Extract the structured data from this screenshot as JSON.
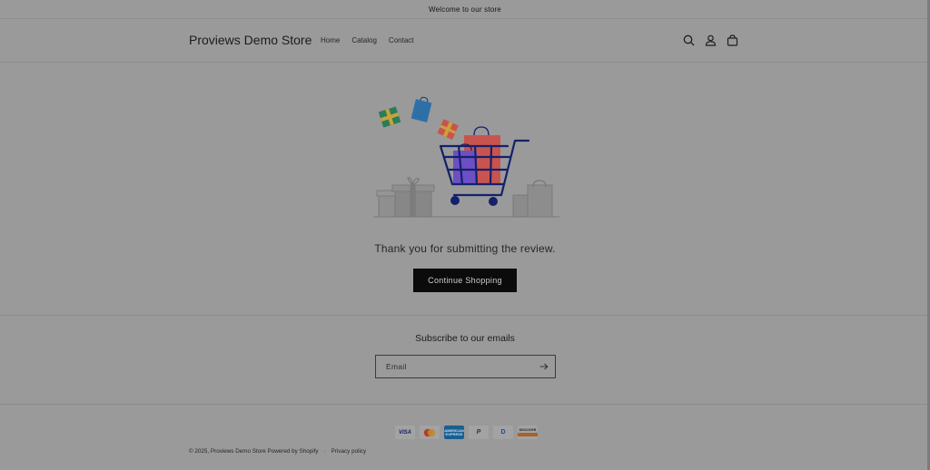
{
  "announcement": {
    "text": "Welcome to our store"
  },
  "header": {
    "store_name": "Proviews Demo Store",
    "nav": [
      "Home",
      "Catalog",
      "Contact"
    ],
    "icons": [
      "search-icon",
      "account-icon",
      "cart-icon"
    ]
  },
  "main": {
    "message": "Thank you for submitting the review.",
    "button_label": "Continue Shopping"
  },
  "newsletter": {
    "title": "Subscribe to our emails",
    "placeholder": "Email"
  },
  "footer": {
    "payments": [
      {
        "name": "Visa",
        "label": "VISA"
      },
      {
        "name": "Mastercard",
        "label": ""
      },
      {
        "name": "American Express",
        "label": "AMERICAN EXPRESS"
      },
      {
        "name": "PayPal",
        "label": "P"
      },
      {
        "name": "Diners Club",
        "label": "D"
      },
      {
        "name": "Discover",
        "label": "DISCOVER"
      }
    ],
    "copyright_prefix": "© 2025,",
    "copyright_store": "Proviews Demo Store",
    "powered_by": "Powered by Shopify",
    "separator": "·",
    "privacy": "Privacy policy"
  },
  "colors": {
    "overlay_background": "#9a9a9a",
    "button": "#0b0b0b",
    "cart_outline": "#13216b",
    "bag_red": "#c9544f",
    "bag_purple": "#6d4fc4",
    "gift_green": "#2a7d5a",
    "gift_blue": "#2e6fa8"
  }
}
